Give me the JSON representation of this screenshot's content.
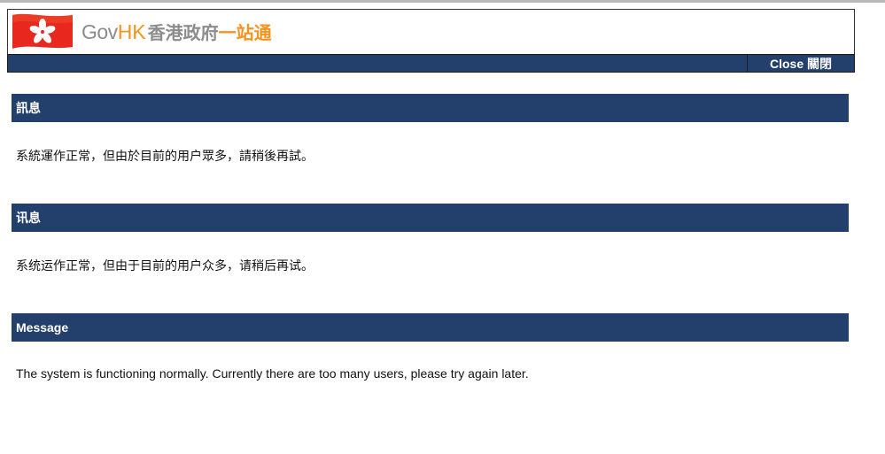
{
  "header": {
    "logo": {
      "gov": "Gov",
      "hk": "HK",
      "zh_part1": "香港政府",
      "zh_part2": "一站通"
    },
    "close_label": "Close 關閉"
  },
  "sections": [
    {
      "title": "訊息",
      "text": "系統運作正常，但由於目前的用户眾多，請稍後再試。"
    },
    {
      "title": "讯息",
      "text": "系统运作正常，但由于目前的用户众多，请稍后再试。"
    },
    {
      "title": "Message",
      "text": "The system is functioning normally. Currently there are too many users, please try again later."
    }
  ],
  "colors": {
    "bar": "#233f6b",
    "logo_gray": "#8c8c8c",
    "logo_orange": "#f7931d",
    "flag_red": "#e8281f"
  }
}
